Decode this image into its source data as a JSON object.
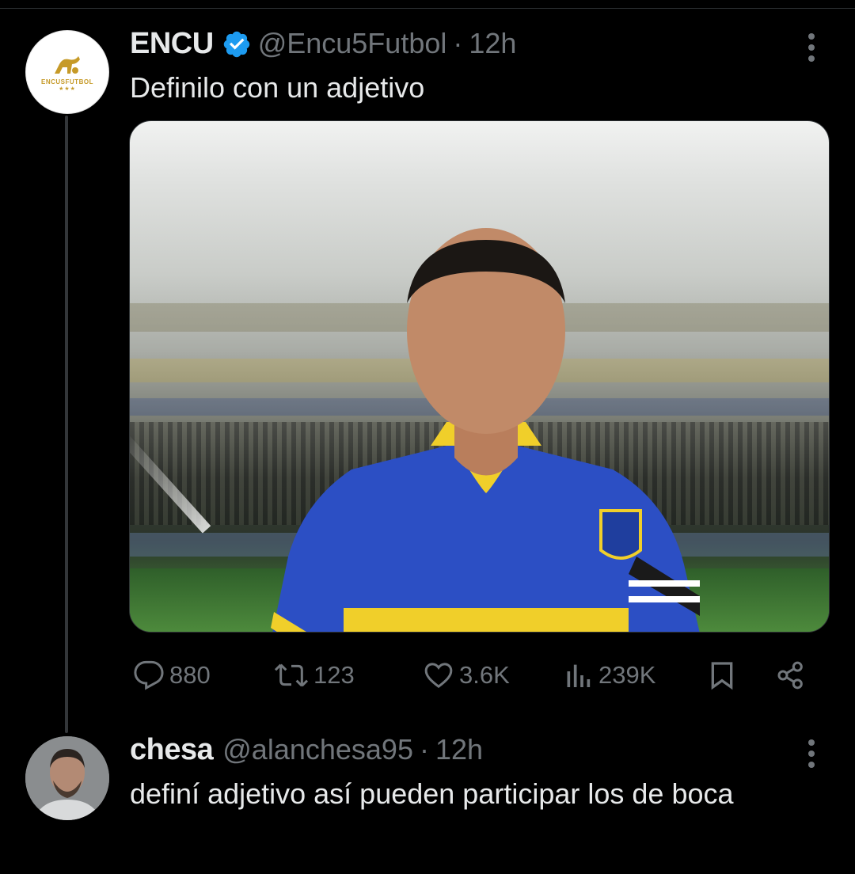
{
  "colors": {
    "background": "#000000",
    "text_primary": "#e7e9ea",
    "text_secondary": "#71767b",
    "verified_blue": "#1d9bf0",
    "thread_line": "#333639",
    "logo_gold": "#c69a28"
  },
  "tweet": {
    "author_name": "ENCU",
    "verified": true,
    "handle": "@Encu5Futbol",
    "separator": "·",
    "time": "12h",
    "text": "Definilo con un adjetivo",
    "avatar": {
      "label": "ENCUSFUTBOL",
      "stars": "★★★"
    },
    "media": {
      "icon": "photo"
    },
    "actions": {
      "replies": "880",
      "reposts": "123",
      "likes": "3.6K",
      "views": "239K"
    },
    "icons": [
      "reply-icon",
      "repost-icon",
      "like-icon",
      "views-icon",
      "bookmark-icon",
      "share-icon",
      "more-icon",
      "verified-badge-icon"
    ]
  },
  "reply": {
    "author_name": "chesa",
    "handle": "@alanchesa95",
    "separator": "·",
    "time": "12h",
    "text": "definí adjetivo así pueden participar los de boca"
  }
}
